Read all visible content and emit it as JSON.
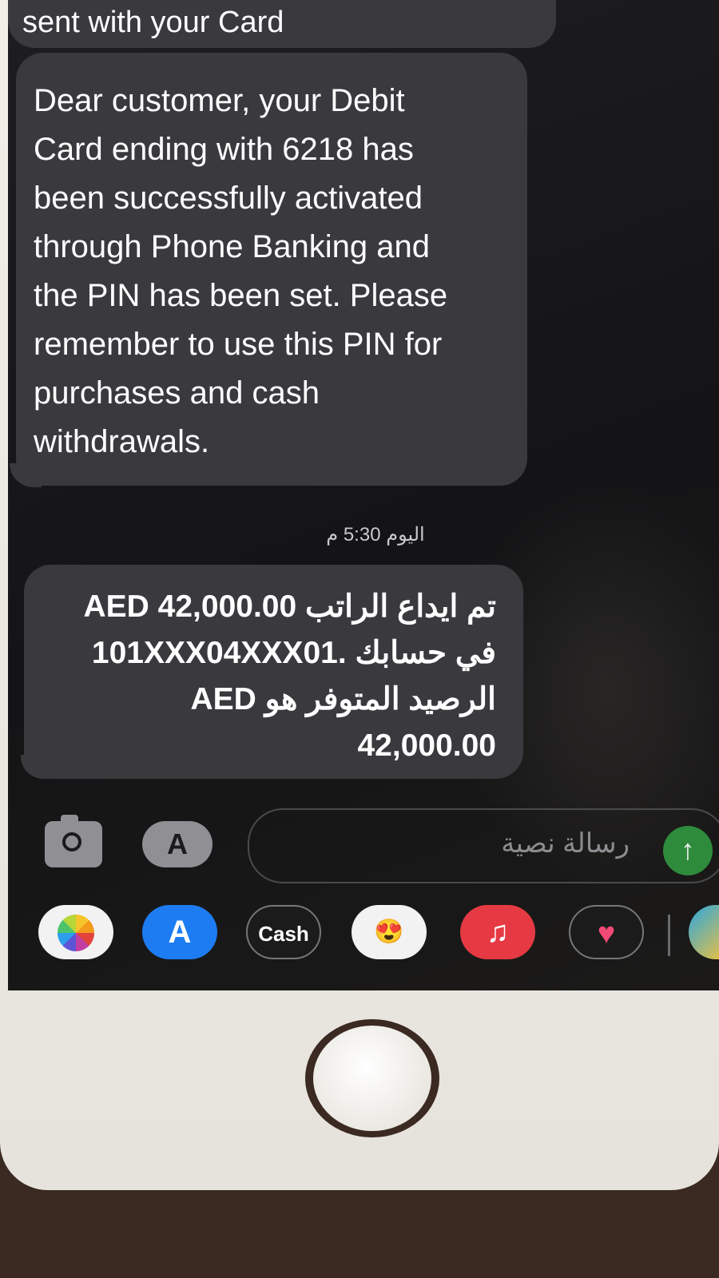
{
  "messages": {
    "previous_tail": "sent with your Card",
    "activation": {
      "lines": [
        "Dear customer, your  Debit",
        "Card ending with 6218 has",
        "been successfully activated",
        "through Phone Banking and",
        "the PIN has been set. Please",
        "remember to use this PIN for",
        "purchases and cash",
        "withdrawals."
      ]
    },
    "timestamp": "اليوم 5:30 م",
    "salary": {
      "lines": [
        "تم ايداع الراتب AED 42,000.00",
        "في  حسابك .101XXX04XXX01",
        "الرصيد المتوفر هو AED",
        "42,000.00"
      ]
    }
  },
  "composer": {
    "placeholder": "رسالة نصية",
    "send_icon": "↑",
    "apps_icon": "A"
  },
  "app_drawer": {
    "store_icon": "A",
    "cash_label": "Cash",
    "memoji_icon": "😍",
    "music_icon": "♫",
    "digital_touch_icon": "♥"
  }
}
